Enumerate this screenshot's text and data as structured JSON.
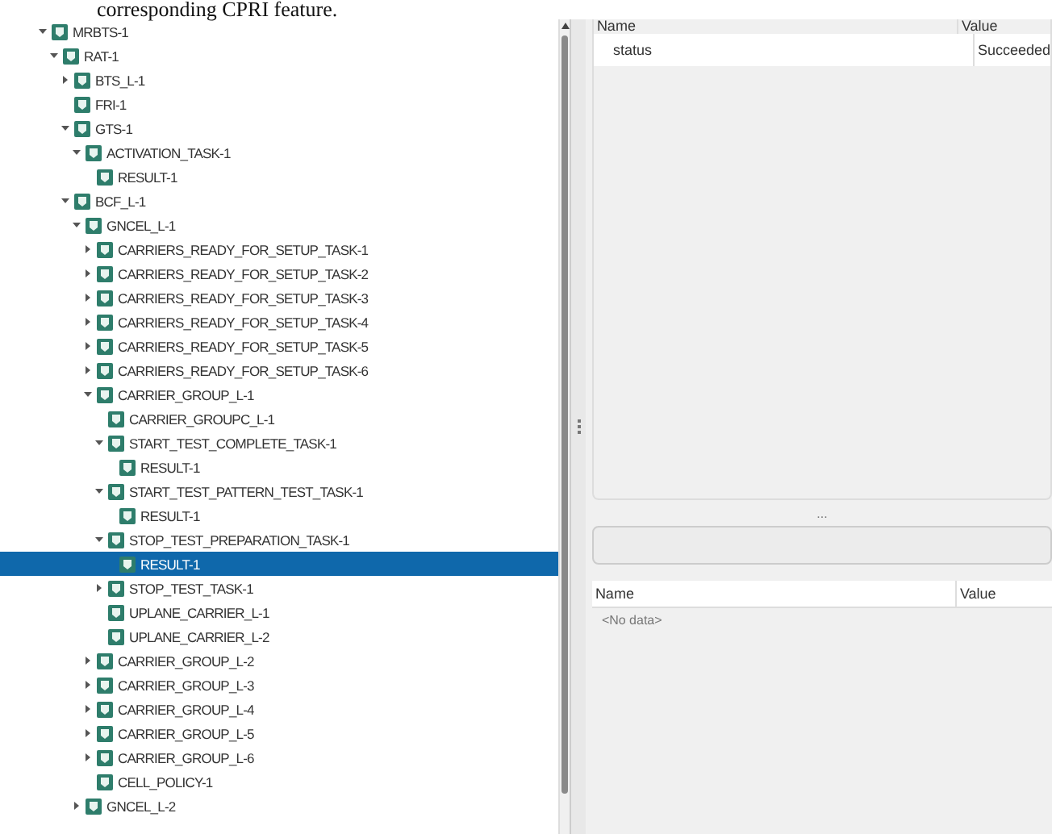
{
  "caption": "corresponding CPRI feature.",
  "tree": [
    {
      "label": "MRBTS-1",
      "expanded": true,
      "selected": false,
      "children": [
        {
          "label": "RAT-1",
          "expanded": true,
          "selected": false,
          "children": [
            {
              "label": "BTS_L-1",
              "expanded": false,
              "selected": false
            },
            {
              "label": "FRI-1",
              "selected": false
            },
            {
              "label": "GTS-1",
              "expanded": true,
              "selected": false,
              "children": [
                {
                  "label": "ACTIVATION_TASK-1",
                  "expanded": true,
                  "selected": false,
                  "children": [
                    {
                      "label": "RESULT-1",
                      "selected": false
                    }
                  ]
                }
              ]
            },
            {
              "label": "BCF_L-1",
              "expanded": true,
              "selected": false,
              "children": [
                {
                  "label": "GNCEL_L-1",
                  "expanded": true,
                  "selected": false,
                  "children": [
                    {
                      "label": "CARRIERS_READY_FOR_SETUP_TASK-1",
                      "expanded": false,
                      "selected": false
                    },
                    {
                      "label": "CARRIERS_READY_FOR_SETUP_TASK-2",
                      "expanded": false,
                      "selected": false
                    },
                    {
                      "label": "CARRIERS_READY_FOR_SETUP_TASK-3",
                      "expanded": false,
                      "selected": false
                    },
                    {
                      "label": "CARRIERS_READY_FOR_SETUP_TASK-4",
                      "expanded": false,
                      "selected": false
                    },
                    {
                      "label": "CARRIERS_READY_FOR_SETUP_TASK-5",
                      "expanded": false,
                      "selected": false
                    },
                    {
                      "label": "CARRIERS_READY_FOR_SETUP_TASK-6",
                      "expanded": false,
                      "selected": false
                    },
                    {
                      "label": "CARRIER_GROUP_L-1",
                      "expanded": true,
                      "selected": false,
                      "children": [
                        {
                          "label": "CARRIER_GROUPC_L-1",
                          "selected": false
                        },
                        {
                          "label": "START_TEST_COMPLETE_TASK-1",
                          "expanded": true,
                          "selected": false,
                          "children": [
                            {
                              "label": "RESULT-1",
                              "selected": false
                            }
                          ]
                        },
                        {
                          "label": "START_TEST_PATTERN_TEST_TASK-1",
                          "expanded": true,
                          "selected": false,
                          "children": [
                            {
                              "label": "RESULT-1",
                              "selected": false
                            }
                          ]
                        },
                        {
                          "label": "STOP_TEST_PREPARATION_TASK-1",
                          "expanded": true,
                          "selected": false,
                          "children": [
                            {
                              "label": "RESULT-1",
                              "selected": true
                            }
                          ]
                        },
                        {
                          "label": "STOP_TEST_TASK-1",
                          "expanded": false,
                          "selected": false
                        },
                        {
                          "label": "UPLANE_CARRIER_L-1",
                          "selected": false
                        },
                        {
                          "label": "UPLANE_CARRIER_L-2",
                          "selected": false
                        }
                      ]
                    },
                    {
                      "label": "CARRIER_GROUP_L-2",
                      "expanded": false,
                      "selected": false
                    },
                    {
                      "label": "CARRIER_GROUP_L-3",
                      "expanded": false,
                      "selected": false
                    },
                    {
                      "label": "CARRIER_GROUP_L-4",
                      "expanded": false,
                      "selected": false
                    },
                    {
                      "label": "CARRIER_GROUP_L-5",
                      "expanded": false,
                      "selected": false
                    },
                    {
                      "label": "CARRIER_GROUP_L-6",
                      "expanded": false,
                      "selected": false
                    },
                    {
                      "label": "CELL_POLICY-1",
                      "selected": false
                    }
                  ]
                },
                {
                  "label": "GNCEL_L-2",
                  "expanded": false,
                  "selected": false
                }
              ]
            }
          ]
        }
      ]
    }
  ],
  "properties": {
    "columns": [
      "Name",
      "Value"
    ],
    "rows": [
      {
        "name": "status",
        "value": "Succeeded"
      }
    ]
  },
  "splitter_grip": "...",
  "details": {
    "columns": [
      "Name",
      "Value"
    ],
    "empty_text": "<No data>"
  }
}
